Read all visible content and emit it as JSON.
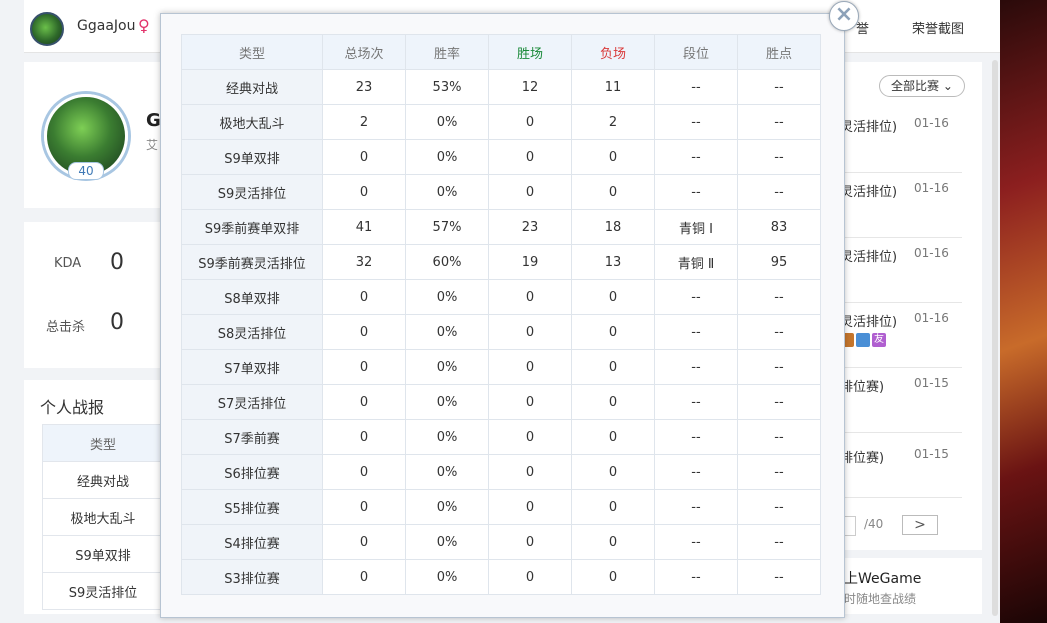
{
  "topbar": {
    "username": "GgaaJou",
    "gender_symbol": "♀",
    "links": [
      "荣誉截图"
    ],
    "link_partial": "誉"
  },
  "profile": {
    "level": "40",
    "name_partial": "G",
    "sub_partial": "艾"
  },
  "stats": {
    "kda_label": "KDA",
    "kda_value": "0",
    "kills_label": "总击杀",
    "kills_value": "0"
  },
  "report": {
    "title": "个人战报",
    "header": "类型",
    "rows": [
      "经典对战",
      "极地大乱斗",
      "S9单双排",
      "S9灵活排位"
    ]
  },
  "matches": {
    "filter_label": "全部比赛",
    "items": [
      {
        "mode": "灵活排位)",
        "date": "01-16"
      },
      {
        "mode": "灵活排位)",
        "date": "01-16"
      },
      {
        "mode": "灵活排位)",
        "date": "01-16"
      },
      {
        "mode": "灵活排位)",
        "date": "01-16",
        "tags": [
          "",
          "",
          "友"
        ]
      },
      {
        "mode": "排位赛)",
        "date": "01-15"
      },
      {
        "mode": "排位赛)",
        "date": "01-15"
      }
    ],
    "pager_total": "/40",
    "next_symbol": ">"
  },
  "wegame": {
    "line1": "上WeGame",
    "line2": "时随地查战绩"
  },
  "modal": {
    "close_symbol": "×",
    "headers": {
      "type": "类型",
      "total": "总场次",
      "rate": "胜率",
      "win": "胜场",
      "loss": "负场",
      "rank": "段位",
      "points": "胜点"
    },
    "colors": {
      "win": "#1b8a3a",
      "loss": "#d93a3a"
    },
    "rows": [
      {
        "type": "经典对战",
        "total": "23",
        "rate": "53%",
        "win": "12",
        "loss": "11",
        "rank": "--",
        "points": "--"
      },
      {
        "type": "极地大乱斗",
        "total": "2",
        "rate": "0%",
        "win": "0",
        "loss": "2",
        "rank": "--",
        "points": "--"
      },
      {
        "type": "S9单双排",
        "total": "0",
        "rate": "0%",
        "win": "0",
        "loss": "0",
        "rank": "--",
        "points": "--"
      },
      {
        "type": "S9灵活排位",
        "total": "0",
        "rate": "0%",
        "win": "0",
        "loss": "0",
        "rank": "--",
        "points": "--"
      },
      {
        "type": "S9季前赛单双排",
        "total": "41",
        "rate": "57%",
        "win": "23",
        "loss": "18",
        "rank": "青铜 Ⅰ",
        "points": "83"
      },
      {
        "type": "S9季前赛灵活排位",
        "total": "32",
        "rate": "60%",
        "win": "19",
        "loss": "13",
        "rank": "青铜 Ⅱ",
        "points": "95"
      },
      {
        "type": "S8单双排",
        "total": "0",
        "rate": "0%",
        "win": "0",
        "loss": "0",
        "rank": "--",
        "points": "--"
      },
      {
        "type": "S8灵活排位",
        "total": "0",
        "rate": "0%",
        "win": "0",
        "loss": "0",
        "rank": "--",
        "points": "--"
      },
      {
        "type": "S7单双排",
        "total": "0",
        "rate": "0%",
        "win": "0",
        "loss": "0",
        "rank": "--",
        "points": "--"
      },
      {
        "type": "S7灵活排位",
        "total": "0",
        "rate": "0%",
        "win": "0",
        "loss": "0",
        "rank": "--",
        "points": "--"
      },
      {
        "type": "S7季前赛",
        "total": "0",
        "rate": "0%",
        "win": "0",
        "loss": "0",
        "rank": "--",
        "points": "--"
      },
      {
        "type": "S6排位赛",
        "total": "0",
        "rate": "0%",
        "win": "0",
        "loss": "0",
        "rank": "--",
        "points": "--"
      },
      {
        "type": "S5排位赛",
        "total": "0",
        "rate": "0%",
        "win": "0",
        "loss": "0",
        "rank": "--",
        "points": "--"
      },
      {
        "type": "S4排位赛",
        "total": "0",
        "rate": "0%",
        "win": "0",
        "loss": "0",
        "rank": "--",
        "points": "--"
      },
      {
        "type": "S3排位赛",
        "total": "0",
        "rate": "0%",
        "win": "0",
        "loss": "0",
        "rank": "--",
        "points": "--"
      }
    ]
  }
}
